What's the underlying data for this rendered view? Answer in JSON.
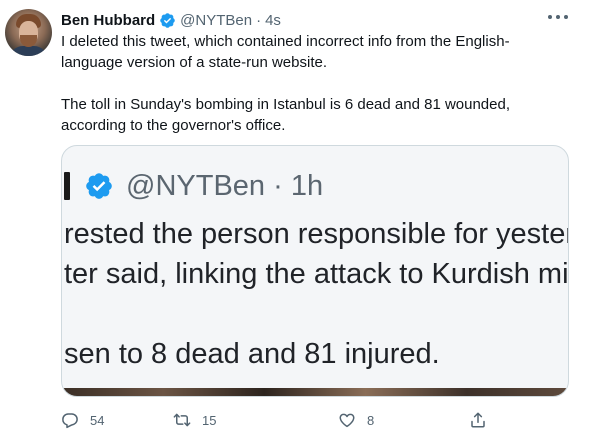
{
  "author": {
    "name": "Ben Hubbard",
    "handle": "@NYTBen",
    "separator": "·",
    "time": "4s"
  },
  "body": {
    "paragraph_1": "I deleted this tweet, which contained incorrect info from the English-language version of a state-run website.",
    "paragraph_2": "The toll in Sunday's bombing in Istanbul is 6 dead and 81 wounded, according to the governor's office."
  },
  "media": {
    "handle": "@NYTBen",
    "separator": "·",
    "time": "1h",
    "line_1": "rested the person responsible for yester",
    "line_2": "ter said, linking the attack to Kurdish mi",
    "line_3": "sen to 8 dead and 81 injured."
  },
  "actions": {
    "reply_count": "54",
    "retweet_count": "15",
    "like_count": "8"
  },
  "icons": {
    "verified": "verified-badge-icon",
    "more": "more-options-icon",
    "reply": "reply-icon",
    "retweet": "retweet-icon",
    "like": "heart-icon",
    "share": "share-icon"
  },
  "colors": {
    "accent": "#1d9bf0",
    "secondary_text": "#536471",
    "border": "#cfd9de"
  }
}
